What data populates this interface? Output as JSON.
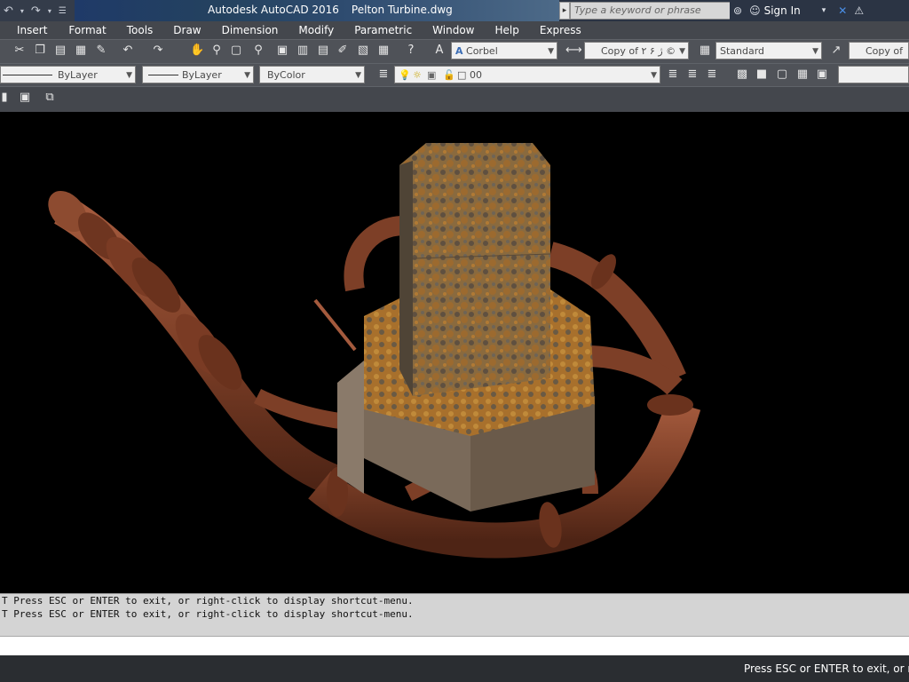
{
  "quick_access": {
    "undo_icon": "undo-icon",
    "redo_icon": "redo-icon"
  },
  "title": {
    "app": "Autodesk AutoCAD 2016",
    "file": "Pelton Turbine.dwg"
  },
  "search": {
    "placeholder": "Type a keyword or phrase"
  },
  "account": {
    "sign_in": "Sign In"
  },
  "menu": [
    "Insert",
    "Format",
    "Tools",
    "Draw",
    "Dimension",
    "Modify",
    "Parametric",
    "Window",
    "Help",
    "Express"
  ],
  "toolbar1": {
    "text_style": "Corbel",
    "dim_style": "Copy of ۲ ۶ ژ ©",
    "table_style": "Standard",
    "multileader_style": "Copy of S"
  },
  "toolbar2": {
    "linetype": "ByLayer",
    "lineweight": "ByLayer",
    "color": "ByColor",
    "layer": "00"
  },
  "command_history": [
    "T Press ESC or ENTER to exit, or right-click to display shortcut-menu.",
    "T Press ESC or ENTER to exit, or right-click to display shortcut-menu."
  ],
  "status_bar": {
    "prompt": "Press ESC or ENTER to exit, or right-"
  },
  "colors": {
    "pipe": "#8a4a33",
    "housing": "#7a6a5a",
    "rust": "#9c6a2f",
    "background": "#000000"
  }
}
